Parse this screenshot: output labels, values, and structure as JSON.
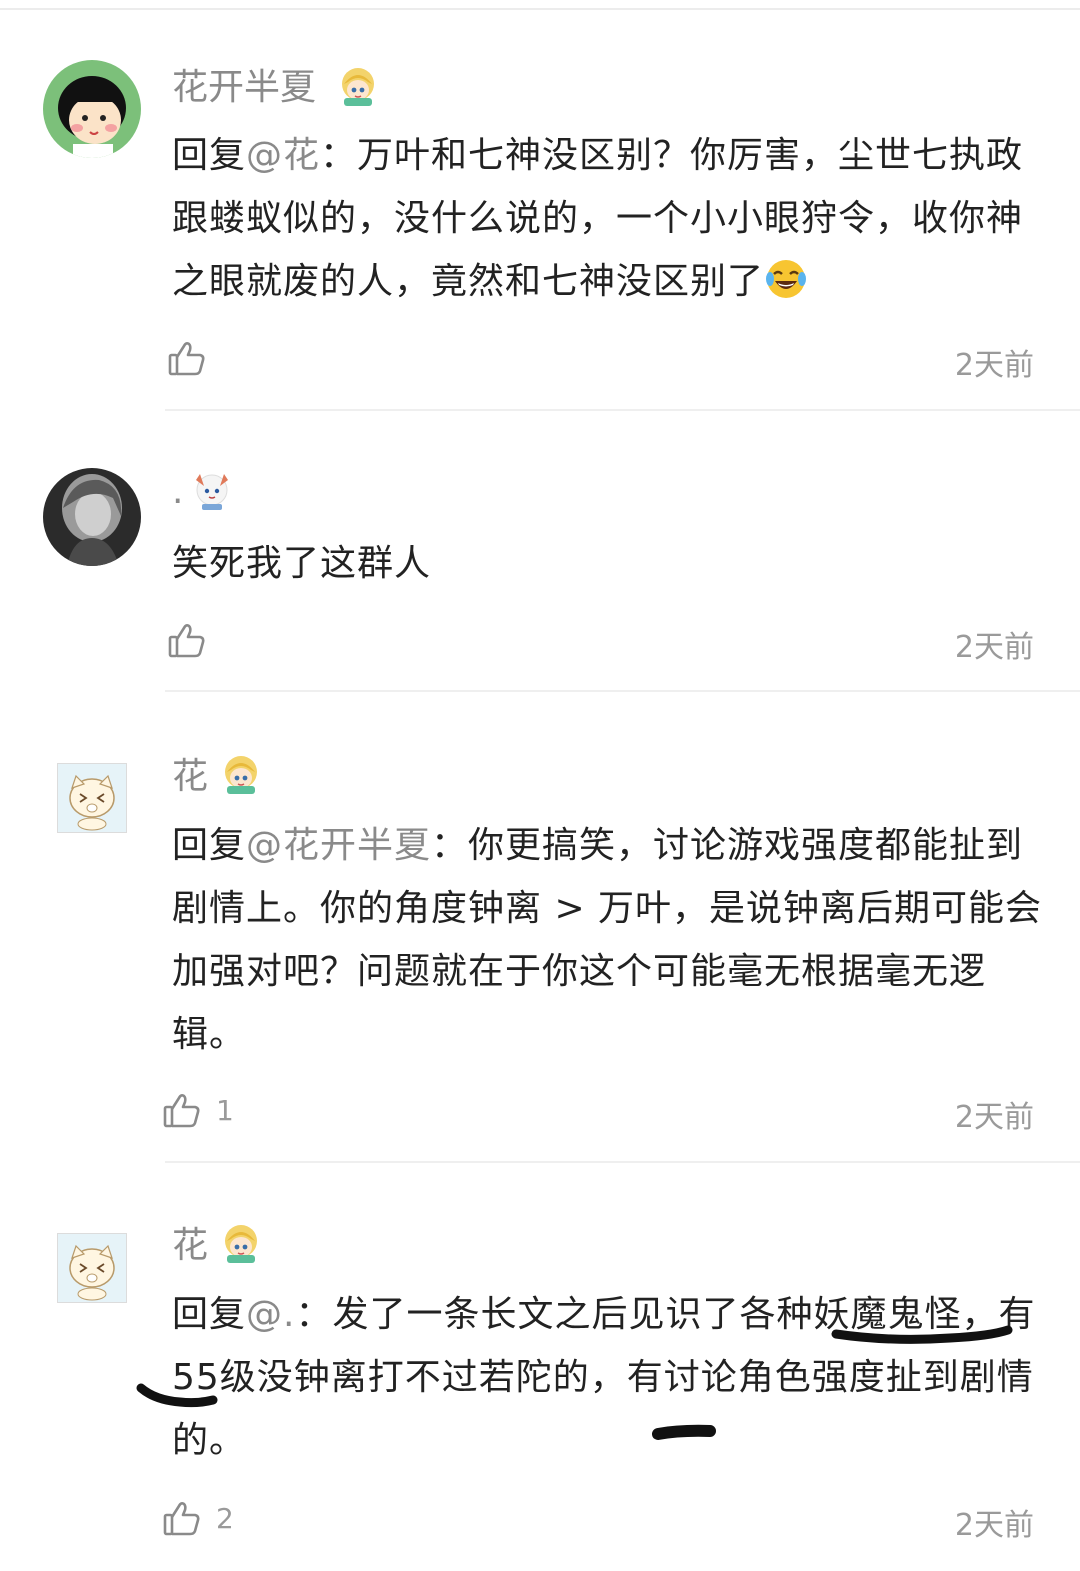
{
  "comments": [
    {
      "username": "花开半夏",
      "reply_prefix": "回复",
      "mention": "@花",
      "text": "：万叶和七神没区别？你厉害，尘世七执政跟蝼蚁似的，没什么说的，一个小小眼狩令，收你神之眼就废的人，竟然和七神没区别了",
      "emoji": "laughing-crying-emoji",
      "likes": "",
      "time": "2天前"
    },
    {
      "username": ".",
      "reply_prefix": "",
      "mention": "",
      "text": "笑死我了这群人",
      "likes": "",
      "time": "2天前"
    },
    {
      "username": "花",
      "reply_prefix": "回复",
      "mention": "@花开半夏",
      "text": "：你更搞笑，讨论游戏强度都能扯到剧情上。你的角度钟离 > 万叶，是说钟离后期可能会加强对吧？问题就在于你这个可能毫无根据毫无逻辑。",
      "likes": "1",
      "time": "2天前"
    },
    {
      "username": "花",
      "reply_prefix": "回复",
      "mention": "@.",
      "text": "：发了一条长文之后见识了各种妖魔鬼怪，有55级没钟离打不过若陀的，有讨论角色强度扯到剧情的。",
      "likes": "2",
      "time": "2天前"
    }
  ],
  "colors": {
    "username": "#8a8a8a",
    "body": "#222222",
    "meta": "#9a9a9a",
    "divider": "#efefef"
  },
  "icons": {
    "like": "thumbs-up-outline-icon",
    "badge": "anime-character-badge"
  }
}
